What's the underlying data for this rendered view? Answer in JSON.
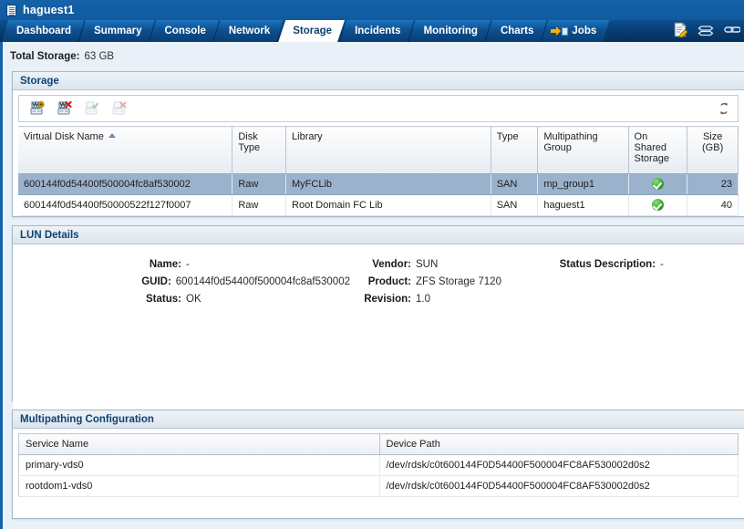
{
  "titlebar": {
    "title": "haguest1",
    "icon": "server-icon"
  },
  "tabs": [
    {
      "label": "Dashboard",
      "active": false
    },
    {
      "label": "Summary",
      "active": false
    },
    {
      "label": "Console",
      "active": false
    },
    {
      "label": "Network",
      "active": false
    },
    {
      "label": "Storage",
      "active": true
    },
    {
      "label": "Incidents",
      "active": false
    },
    {
      "label": "Monitoring",
      "active": false
    },
    {
      "label": "Charts",
      "active": false
    },
    {
      "label": "Jobs",
      "active": false,
      "icon": "jobs-arrow-icon"
    }
  ],
  "top_icons": [
    {
      "name": "edit-note-icon"
    },
    {
      "name": "refresh-cycle-icon"
    },
    {
      "name": "link-icon"
    }
  ],
  "summary": {
    "total_storage_label": "Total Storage:",
    "total_storage_value": "63 GB"
  },
  "storage_panel": {
    "title": "Storage",
    "toolbar": [
      {
        "name": "add-virtual-disk-button",
        "enabled": true
      },
      {
        "name": "delete-virtual-disk-button",
        "enabled": true
      },
      {
        "name": "attach-disk-button",
        "enabled": false
      },
      {
        "name": "detach-disk-button",
        "enabled": false
      }
    ],
    "refresh": {
      "name": "refresh-icon",
      "label": "↻"
    },
    "columns": [
      "Virtual Disk Name",
      "Disk Type",
      "Library",
      "Type",
      "Multipathing Group",
      "On Shared Storage",
      "Size (GB)"
    ],
    "sort_column": "Virtual Disk Name",
    "sort_direction": "asc",
    "rows": [
      {
        "name": "600144f0d54400f500004fc8af530002",
        "disk_type": "Raw",
        "library": "MyFCLib",
        "type": "SAN",
        "multipathing_group": "mp_group1",
        "on_shared_storage": true,
        "size_gb": "23",
        "selected": true
      },
      {
        "name": "600144f0d54400f50000522f127f0007",
        "disk_type": "Raw",
        "library": "Root Domain FC Lib",
        "type": "SAN",
        "multipathing_group": "haguest1",
        "on_shared_storage": true,
        "size_gb": "40",
        "selected": false
      }
    ]
  },
  "lun_details": {
    "title": "LUN Details",
    "fields": {
      "name_label": "Name:",
      "name_value": "-",
      "guid_label": "GUID:",
      "guid_value": "600144f0d54400f500004fc8af530002",
      "status_label": "Status:",
      "status_value": "OK",
      "vendor_label": "Vendor:",
      "vendor_value": "SUN",
      "product_label": "Product:",
      "product_value": "ZFS Storage 7120",
      "revision_label": "Revision:",
      "revision_value": "1.0",
      "status_description_label": "Status Description:",
      "status_description_value": "-"
    }
  },
  "multipathing": {
    "title": "Multipathing Configuration",
    "columns": [
      "Service Name",
      "Device Path"
    ],
    "rows": [
      {
        "service_name": "primary-vds0",
        "device_path": "/dev/rdsk/c0t600144F0D54400F500004FC8AF530002d0s2"
      },
      {
        "service_name": "rootdom1-vds0",
        "device_path": "/dev/rdsk/c0t600144F0D54400F500004FC8AF530002d0s2"
      }
    ]
  },
  "colors": {
    "header_blue": "#1562a8",
    "tab_dark": "#073b6f",
    "panel_title": "#0e4272",
    "selection": "#9bb2cd",
    "status_ok_green": "#35a832",
    "page_bg": "#eaf0f7"
  }
}
